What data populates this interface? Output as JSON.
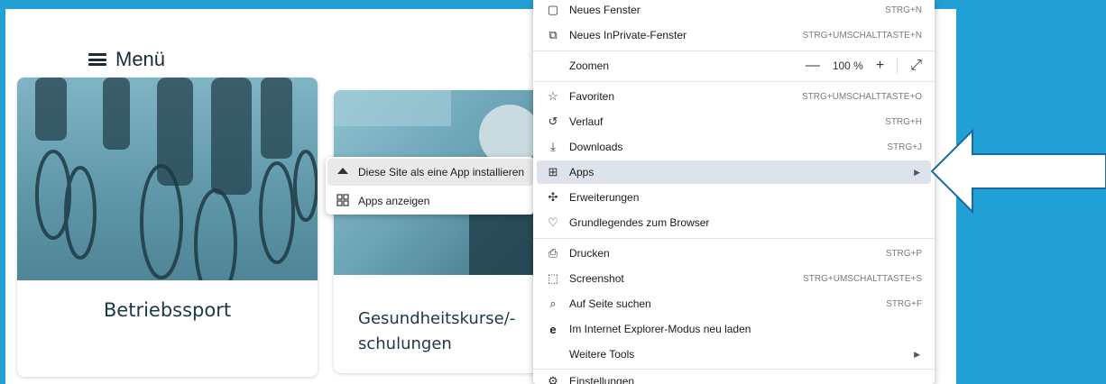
{
  "page": {
    "menu_label": "Menü",
    "cards": [
      {
        "title": "Betriebssport"
      },
      {
        "title": "Gesundheitskurse/-schulungen"
      }
    ]
  },
  "apps_submenu": [
    {
      "label": "Diese Site als eine App installieren",
      "icon": "app-install-icon",
      "highlighted": true
    },
    {
      "label": "Apps anzeigen",
      "icon": "apps-grid-icon",
      "highlighted": false
    }
  ],
  "context_menu": {
    "items": [
      {
        "label": "Neues Fenster",
        "shortcut": "STRG+N",
        "icon": "window-icon"
      },
      {
        "label": "Neues InPrivate-Fenster",
        "shortcut": "STRG+UMSCHALTTASTE+N",
        "icon": "inprivate-icon"
      },
      {
        "label": "Zoomen",
        "zoom_value": "100 %",
        "icon": ""
      },
      {
        "label": "Favoriten",
        "shortcut": "STRG+UMSCHALTTASTE+O",
        "icon": "favorites-star-icon"
      },
      {
        "label": "Verlauf",
        "shortcut": "STRG+H",
        "icon": "history-icon"
      },
      {
        "label": "Downloads",
        "shortcut": "STRG+J",
        "icon": "download-icon"
      },
      {
        "label": "Apps",
        "submenu": true,
        "highlighted": true,
        "icon": "apps-icon"
      },
      {
        "label": "Erweiterungen",
        "icon": "extensions-puzzle-icon"
      },
      {
        "label": "Grundlegendes zum Browser",
        "icon": "browser-essentials-heart-icon"
      },
      {
        "label": "Drucken",
        "shortcut": "STRG+P",
        "icon": "print-icon"
      },
      {
        "label": "Screenshot",
        "shortcut": "STRG+UMSCHALTTASTE+S",
        "icon": "screenshot-icon"
      },
      {
        "label": "Auf Seite suchen",
        "shortcut": "STRG+F",
        "icon": "find-on-page-icon"
      },
      {
        "label": "Im Internet Explorer-Modus neu laden",
        "icon": "ie-mode-icon"
      },
      {
        "label": "Weitere Tools",
        "submenu": true,
        "icon": ""
      },
      {
        "label": "Einstellungen",
        "icon": "settings-gear-icon"
      }
    ]
  },
  "colors": {
    "background": "#21a0d6",
    "menu_highlight": "#dde3ea",
    "card_title": "#1a3947"
  }
}
